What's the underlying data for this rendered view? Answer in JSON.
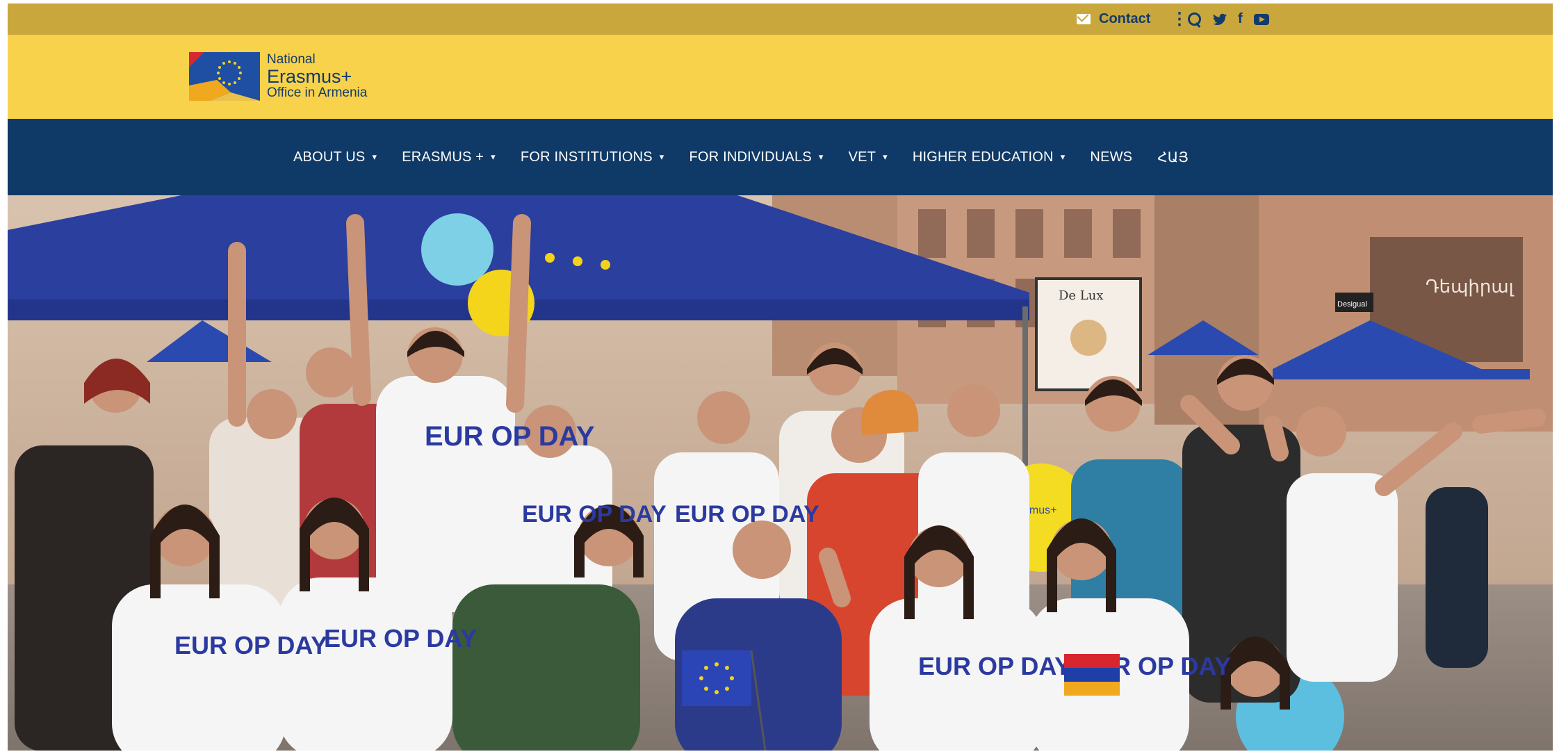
{
  "topbar": {
    "contact_label": "Contact",
    "divider": "⋮",
    "icons": [
      "mail-icon",
      "search-icon",
      "twitter-icon",
      "facebook-icon",
      "youtube-icon"
    ],
    "twitter_glyph": "🐦",
    "facebook_glyph": "f"
  },
  "logo": {
    "line1": "National",
    "line2": "Erasmus+",
    "line3": "Office in Armenia"
  },
  "nav": {
    "items": [
      {
        "label": "ABOUT US",
        "has_dropdown": true
      },
      {
        "label": "ERASMUS +",
        "has_dropdown": true
      },
      {
        "label": "FOR INSTITUTIONS",
        "has_dropdown": true
      },
      {
        "label": "FOR INDIVIDUALS",
        "has_dropdown": true
      },
      {
        "label": "VET",
        "has_dropdown": true
      },
      {
        "label": "HIGHER EDUCATION",
        "has_dropdown": true
      },
      {
        "label": "NEWS",
        "has_dropdown": false
      },
      {
        "label": "ՀԱՅ",
        "has_dropdown": false
      }
    ],
    "caret": "▾"
  },
  "hero": {
    "tshirt_text": "EUR OP DAY",
    "balloon_text": "Erasmus+",
    "sign_text": "De Lux",
    "storefront_text": "Դեպիրալ",
    "store_brand": "Desigual"
  },
  "colors": {
    "topbar": "#c9a73c",
    "logo_band": "#f8d24b",
    "nav": "#0f3966",
    "text_dark_blue": "#123b6b",
    "eu_blue": "#2b45b7",
    "eu_yellow": "#f5d21a"
  }
}
